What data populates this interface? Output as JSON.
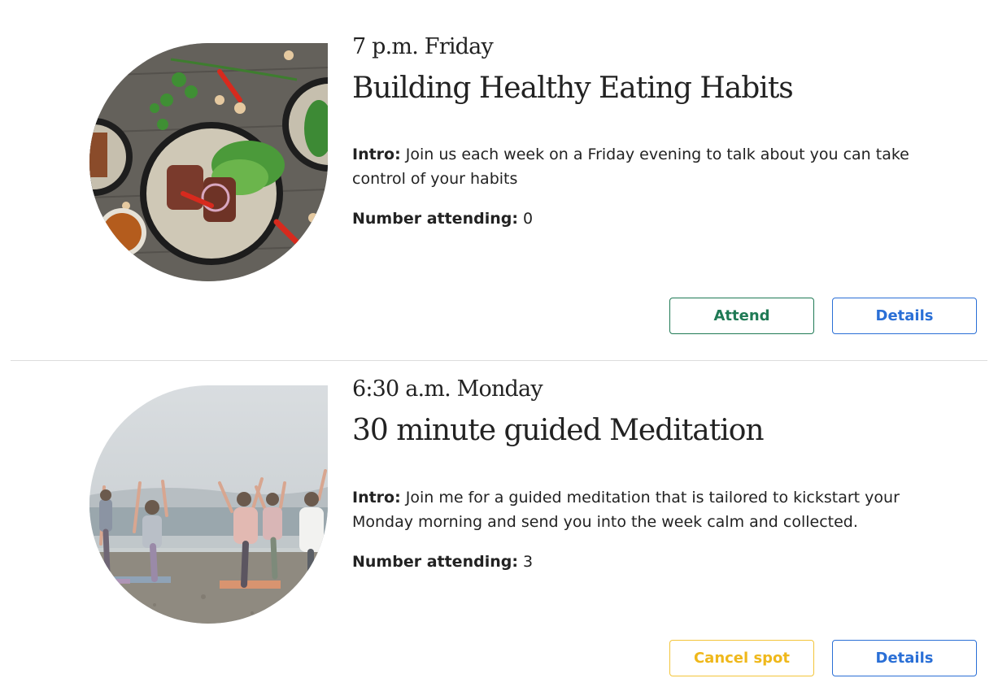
{
  "events": [
    {
      "time": "7 p.m. Friday",
      "title": "Building Healthy Eating Habits",
      "intro_label": "Intro:",
      "intro_text": "Join us each week on a Friday evening to talk about you can take control of your habits",
      "attending_label": "Number attending:",
      "attending_count": "0",
      "primary_button": "Attend",
      "details_button": "Details",
      "image": "food-bowl-photo"
    },
    {
      "time": "6:30 a.m. Monday",
      "title": "30 minute guided Meditation",
      "intro_label": "Intro:",
      "intro_text": "Join me for a guided meditation that is tailored to kickstart your Monday morning and send you into the week calm and collected.",
      "attending_label": "Number attending:",
      "attending_count": "3",
      "primary_button": "Cancel spot",
      "details_button": "Details",
      "image": "beach-yoga-photo"
    }
  ],
  "colors": {
    "attend": "#1f7a55",
    "cancel": "#efb81b",
    "details": "#2a6fd6"
  }
}
